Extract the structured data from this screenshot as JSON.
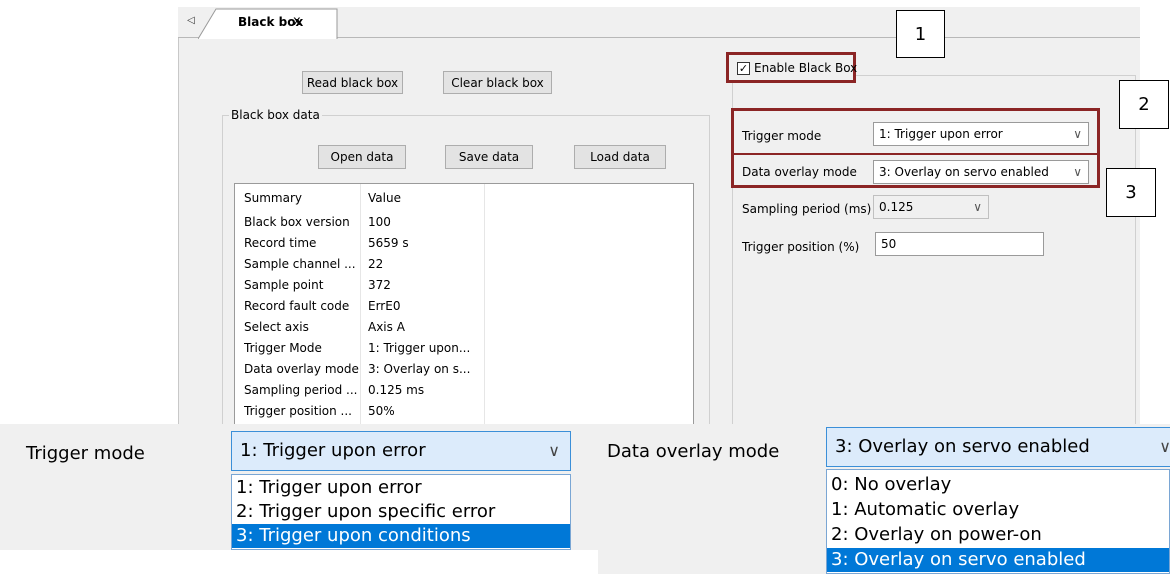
{
  "tab": {
    "scroll_glyph": "◁",
    "label": "Black box",
    "close": "x"
  },
  "buttons": {
    "read": "Read black box",
    "clear": "Clear black box",
    "open": "Open data",
    "save": "Save data",
    "load": "Load data"
  },
  "black_box_data": {
    "legend": "Black box data",
    "header": {
      "key": "Summary",
      "value": "Value"
    },
    "rows": [
      {
        "key": "Black box version",
        "value": "100"
      },
      {
        "key": "Record time",
        "value": "5659 s"
      },
      {
        "key": "Sample channel ...",
        "value": "22"
      },
      {
        "key": "Sample point",
        "value": "372"
      },
      {
        "key": "Record fault code",
        "value": "ErrE0"
      },
      {
        "key": "Select axis",
        "value": "Axis A"
      },
      {
        "key": "Trigger Mode",
        "value": "1: Trigger upon..."
      },
      {
        "key": "Data overlay mode",
        "value": "3: Overlay on s..."
      },
      {
        "key": "Sampling period ...",
        "value": "0.125 ms"
      },
      {
        "key": "Trigger position ...",
        "value": "50%"
      }
    ]
  },
  "settings": {
    "enable_label": "Enable Black Box",
    "enable_checked": true,
    "trigger_mode_label": "Trigger mode",
    "trigger_mode_value": "1: Trigger upon error",
    "overlay_label": "Data overlay mode",
    "overlay_value": "3: Overlay on servo enabled",
    "sampling_label": "Sampling period (ms)",
    "sampling_value": "0.125",
    "position_label": "Trigger position (%)",
    "position_value": "50"
  },
  "callouts": [
    "1",
    "2",
    "3"
  ],
  "zoom_trigger": {
    "label": "Trigger mode",
    "selected": "1: Trigger upon error",
    "options": [
      "1: Trigger upon error",
      "2: Trigger upon specific error",
      "3: Trigger upon conditions"
    ],
    "highlighted_index": 2
  },
  "zoom_overlay": {
    "label": "Data overlay mode",
    "selected": "3: Overlay on servo enabled",
    "options": [
      "0: No overlay",
      "1: Automatic overlay",
      "2: Overlay on power-on",
      "3: Overlay on servo enabled"
    ],
    "highlighted_index": 3
  },
  "colors": {
    "callout_border": "#8b2525",
    "selection": "#0078d7",
    "dropdown_focus": "#dcebfb"
  }
}
